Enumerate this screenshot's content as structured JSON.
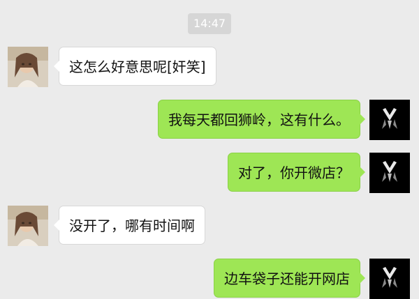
{
  "chat": {
    "timestamp": "14:47",
    "messages": [
      {
        "side": "left",
        "text": "这怎么好意思呢[奸笑]",
        "avatar": "girl-photo-avatar"
      },
      {
        "side": "right",
        "text": "我每天都回狮岭，这有什么。",
        "avatar": "black-suit-avatar"
      },
      {
        "side": "right",
        "text": "对了，你开微店？",
        "avatar": "black-suit-avatar"
      },
      {
        "side": "left",
        "text": "没开了，哪有时间啊",
        "avatar": "girl-photo-avatar"
      },
      {
        "side": "right",
        "text": "边车袋子还能开网店",
        "avatar": "black-suit-avatar"
      }
    ]
  },
  "colors": {
    "background": "#ebebeb",
    "bubble_sent": "#9ee655",
    "bubble_received": "#ffffff",
    "timestamp_bg": "#d6d6d6"
  }
}
